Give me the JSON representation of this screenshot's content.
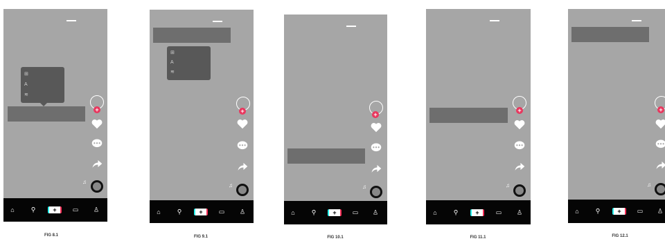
{
  "figures": [
    {
      "label": "FIG 8.1"
    },
    {
      "label": "FIG 9.1"
    },
    {
      "label": "FIG 10.1"
    },
    {
      "label": "FIG 11.1"
    },
    {
      "label": "FIG 12.1"
    }
  ],
  "colors": {
    "screen": "#a6a6a6",
    "caption_box": "#6e6e6e",
    "popup": "#585858",
    "nav_bar": "#050505",
    "accent": "#e8365d"
  },
  "icons": [
    "avatar",
    "follow-plus-icon",
    "heart-icon",
    "comment-icon",
    "share-icon",
    "music-disc-icon",
    "home-icon",
    "search-icon",
    "create-icon",
    "inbox-icon",
    "profile-icon"
  ]
}
